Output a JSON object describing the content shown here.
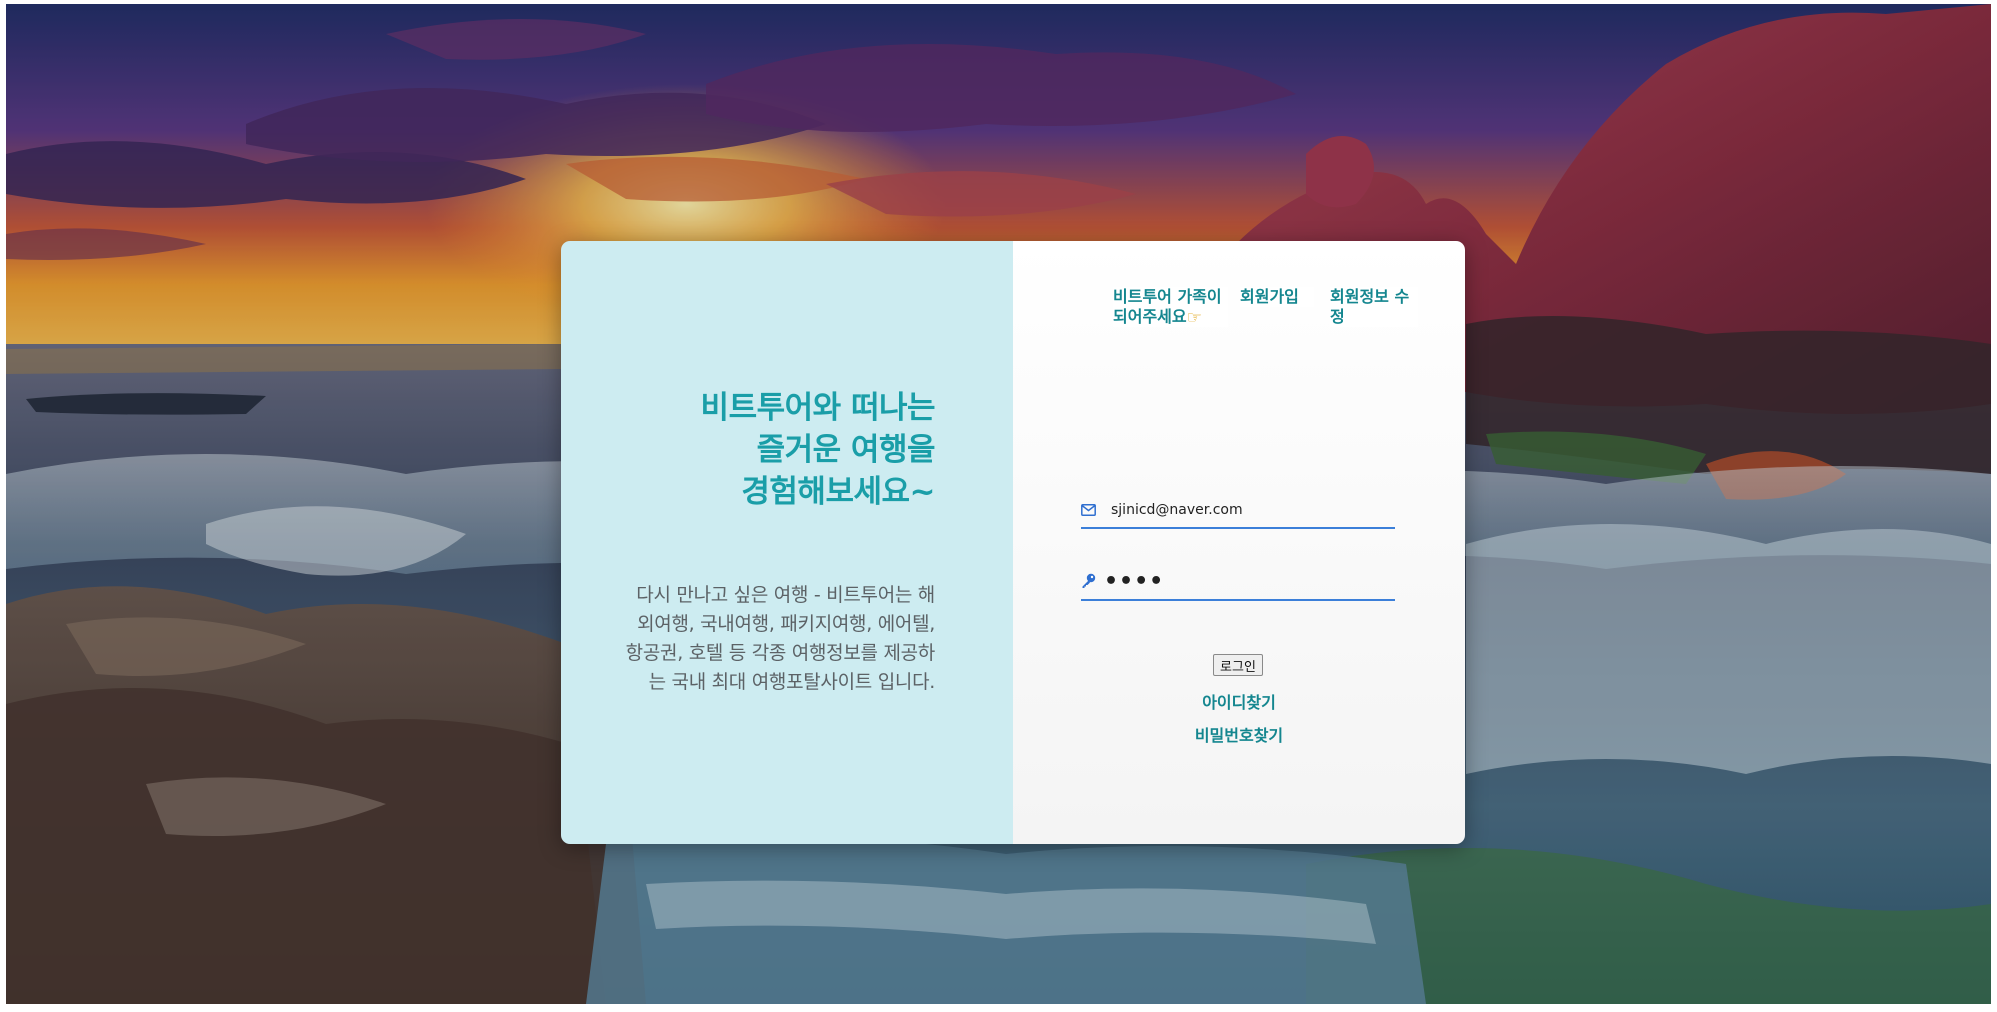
{
  "intro": {
    "headline_lines": [
      "비트투어와 떠나는",
      "즐거운 여행을",
      "경험해보세요~"
    ],
    "description": "다시 만나고 싶은 여행 - 비트투어는 해외여행, 국내여행, 패키지여행, 에어텔, 항공권, 호텔 등 각종 여행정보를 제공하는 국내 최대 여행포탈사이트 입니다."
  },
  "top_links": {
    "join_family": "비트투어 가족이 되어주세요",
    "join_family_icon": "pointing-hand-icon",
    "signup": "회원가입",
    "edit_member": "회원정보 수정"
  },
  "login_form": {
    "email_icon": "mail-icon",
    "email_value": "sjinicd@naver.com",
    "password_icon": "key-icon",
    "password_value": "1234",
    "login_button": "로그인",
    "find_id": "아이디찾기",
    "find_password": "비밀번호찾기"
  },
  "colors": {
    "accent_teal": "#1a9ea8",
    "link_teal": "#14868f",
    "input_underline": "#3b7fd9",
    "left_panel_bg": "#cdecf1"
  }
}
